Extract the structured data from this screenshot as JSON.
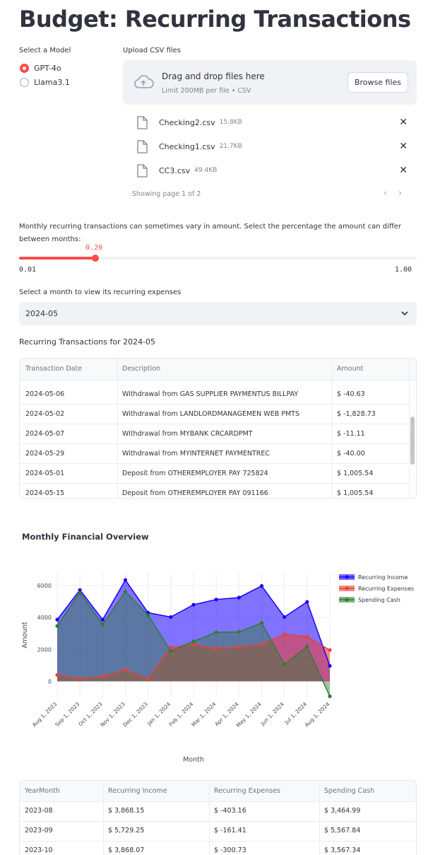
{
  "app": {
    "title": "Budget: Recurring Transactions"
  },
  "model": {
    "label": "Select a Model",
    "options": [
      "GPT-4o",
      "Llama3.1"
    ],
    "selected": "GPT-4o"
  },
  "upload": {
    "label": "Upload CSV files",
    "dropzone_title": "Drag and drop files here",
    "dropzone_hint": "Limit 200MB per file • CSV",
    "browse_label": "Browse files",
    "files": [
      {
        "name": "Checking2.csv",
        "size": "15.8KB"
      },
      {
        "name": "Checking1.csv",
        "size": "21.7KB"
      },
      {
        "name": "CC3.csv",
        "size": "49.4KB"
      }
    ],
    "pagination": "Showing page 1 of 2"
  },
  "slider": {
    "label": "Monthly recurring transactions can sometimes vary in amount. Select the percentage the amount can differ between months:",
    "value": "0.20",
    "min": "0.01",
    "max": "1.00",
    "value_num": 0.2,
    "min_num": 0.01,
    "max_num": 1.0
  },
  "month_select": {
    "label": "Select a month to view its recurring expenses",
    "value": "2024-05"
  },
  "transactions": {
    "heading": "Recurring Transactions for 2024-05",
    "columns": [
      "Transaction Date",
      "Description",
      "Amount"
    ],
    "rows": [
      [
        "2024-05-06",
        "Withdrawal from GAS SUPPLIER PAYMENTUS BILLPAY",
        "$ -40.63"
      ],
      [
        "2024-05-02",
        "Withdrawal from LANDLORDMANAGEMEN WEB PMTS",
        "$ -1,828.73"
      ],
      [
        "2024-05-07",
        "Withdrawal from MYBANK CRCARDPMT",
        "$ -11.11"
      ],
      [
        "2024-05-29",
        "Withdrawal from MYINTERNET PAYMENTREC",
        "$ -40.00"
      ],
      [
        "2024-05-01",
        "Deposit from OTHEREMPLOYER PAY 725824",
        "$ 1,005.54"
      ],
      [
        "2024-05-15",
        "Deposit from OTHEREMPLOYER PAY 091166",
        "$ 1,005.54"
      ]
    ]
  },
  "overview": {
    "heading": "Monthly Financial Overview"
  },
  "colors": {
    "accent": "#ff4b4b",
    "income": "#1a00ff",
    "expenses": "#e8403a",
    "cash": "#2e7d32"
  },
  "chart_data": {
    "type": "area",
    "title": "",
    "xlabel": "Month",
    "ylabel": "Amount",
    "ylim": [
      -1000,
      6800
    ],
    "yticks": [
      0,
      2000,
      4000,
      6000
    ],
    "grid": true,
    "legend_position": "top-right",
    "x": [
      "Aug 1, 2023",
      "Sep 1, 2023",
      "Oct 1, 2023",
      "Nov 1, 2023",
      "Dec 1, 2023",
      "Jan 1, 2024",
      "Feb 1, 2024",
      "Mar 1, 2024",
      "Apr 1, 2024",
      "May 1, 2024",
      "Jun 1, 2024",
      "Jul 1, 2024",
      "Aug 1, 2024"
    ],
    "series": [
      {
        "name": "Recurring Income",
        "color": "#1a00ff",
        "values": [
          3868,
          5729,
          3868,
          6350,
          4300,
          4030,
          4800,
          5130,
          5250,
          5980,
          4030,
          4980,
          970
        ]
      },
      {
        "name": "Recurring Expenses",
        "color": "#e8403a",
        "values": [
          403,
          161,
          301,
          730,
          150,
          2130,
          2300,
          2060,
          2150,
          2320,
          2950,
          2800,
          1960
        ]
      },
      {
        "name": "Spending Cash",
        "color": "#2e7d32",
        "values": [
          3465,
          5568,
          3567,
          5620,
          4150,
          1900,
          2500,
          3070,
          3100,
          3660,
          1070,
          2180,
          -940
        ]
      }
    ]
  },
  "summary": {
    "columns": [
      "YearMonth",
      "Recurring Income",
      "Recurring Expenses",
      "Spending Cash"
    ],
    "rows": [
      [
        "2023-08",
        "$ 3,868.15",
        "$ -403.16",
        "$ 3,464.99"
      ],
      [
        "2023-09",
        "$ 5,729.25",
        "$ -161.41",
        "$ 5,567.84"
      ],
      [
        "2023-10",
        "$ 3,868.07",
        "$ -300.73",
        "$ 3,567.34"
      ]
    ]
  }
}
